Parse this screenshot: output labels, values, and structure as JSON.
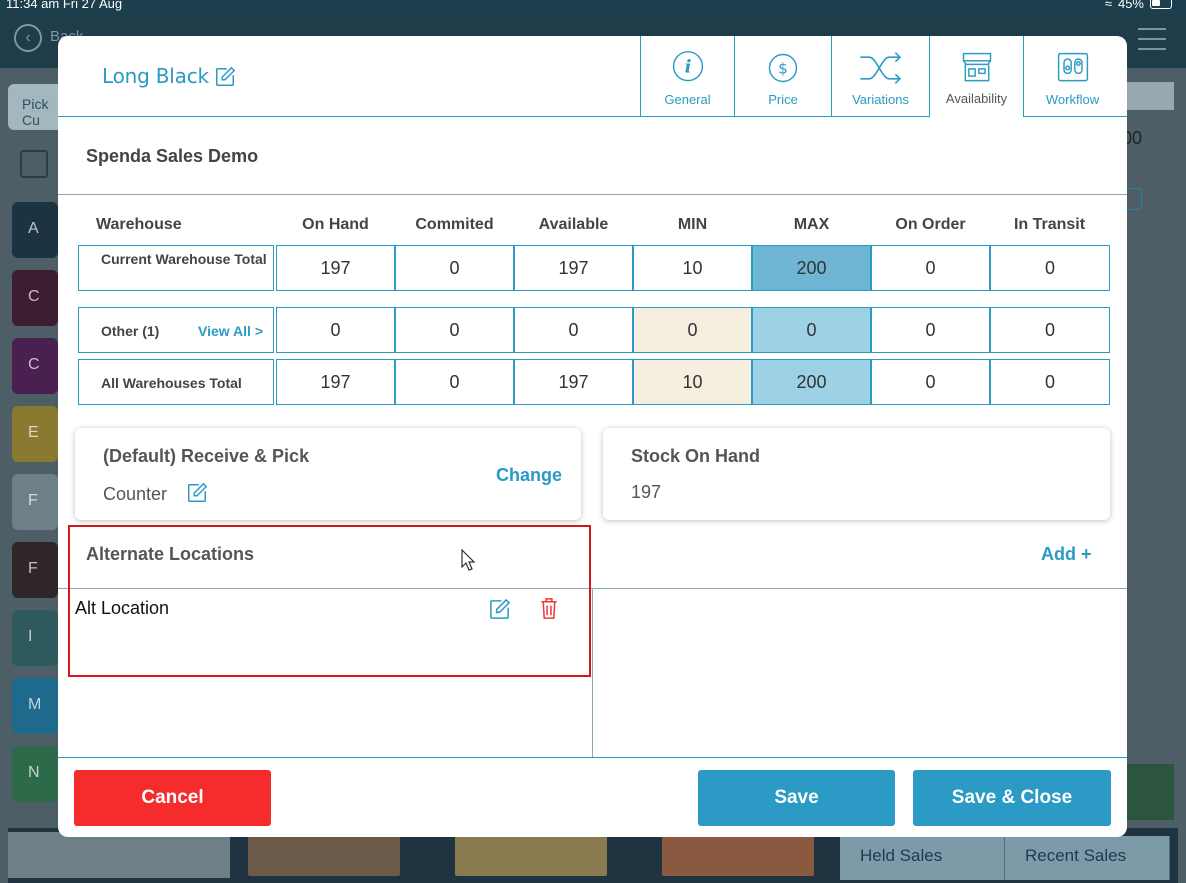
{
  "status_bar": {
    "time": "11:34 am   Fri 27 Aug",
    "battery": "45%"
  },
  "background": {
    "back_label": "Back",
    "pick_label": "Pick Cu",
    "category_tiles": [
      {
        "letter": "A",
        "color": "#1c3442"
      },
      {
        "letter": "C",
        "color": "#3c1e30"
      },
      {
        "letter": "C",
        "color": "#4a2050"
      },
      {
        "letter": "E",
        "color": "#8a7a30"
      },
      {
        "letter": "F",
        "color": "#6d8088"
      },
      {
        "letter": "F",
        "color": "#2e2628"
      },
      {
        "letter": "I",
        "color": "#2e5a5e"
      },
      {
        "letter": "M",
        "color": "#1e6a8c"
      },
      {
        "letter": "N",
        "color": "#2d6a4a"
      }
    ],
    "right_number": "00",
    "held_sales": "Held Sales",
    "recent_sales": "Recent Sales"
  },
  "modal": {
    "product_name": "Long Black",
    "tabs": [
      {
        "label": "General",
        "icon": "info-icon"
      },
      {
        "label": "Price",
        "icon": "dollar-icon"
      },
      {
        "label": "Variations",
        "icon": "shuffle-icon"
      },
      {
        "label": "Availability",
        "icon": "store-icon",
        "active": true
      },
      {
        "label": "Workflow",
        "icon": "workflow-icon"
      }
    ],
    "company": "Spenda Sales Demo",
    "stock": {
      "headers": [
        "Warehouse",
        "On Hand",
        "Commited",
        "Available",
        "MIN",
        "MAX",
        "On Order",
        "In Transit"
      ],
      "rows": [
        {
          "label": "Current Warehouse Total",
          "values": [
            "197",
            "0",
            "197",
            "10",
            "200",
            "0",
            "0"
          ]
        },
        {
          "label": "Other (1)",
          "link": "View All >",
          "values": [
            "0",
            "0",
            "0",
            "0",
            "0",
            "0",
            "0"
          ]
        },
        {
          "label": "All Warehouses Total",
          "values": [
            "197",
            "0",
            "197",
            "10",
            "200",
            "0",
            "0"
          ]
        }
      ]
    },
    "receive_card": {
      "title": "(Default) Receive & Pick",
      "location": "Counter",
      "change_label": "Change"
    },
    "stock_card": {
      "title": "Stock On Hand",
      "value": "197"
    },
    "alternate": {
      "title": "Alternate Locations",
      "add_label": "Add +",
      "items": [
        "Alt Location"
      ]
    },
    "buttons": {
      "cancel": "Cancel",
      "save": "Save",
      "save_close": "Save & Close"
    },
    "colors": {
      "accent": "#2b9ac4",
      "cancel": "#f62b2b",
      "highlight": "#d4171c"
    }
  }
}
